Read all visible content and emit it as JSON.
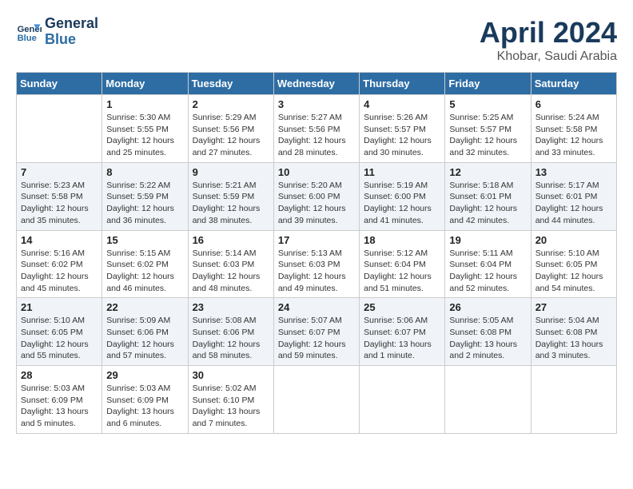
{
  "header": {
    "logo_line1": "General",
    "logo_line2": "Blue",
    "month_title": "April 2024",
    "location": "Khobar, Saudi Arabia"
  },
  "days_of_week": [
    "Sunday",
    "Monday",
    "Tuesday",
    "Wednesday",
    "Thursday",
    "Friday",
    "Saturday"
  ],
  "weeks": [
    [
      {
        "day": "",
        "info": ""
      },
      {
        "day": "1",
        "info": "Sunrise: 5:30 AM\nSunset: 5:55 PM\nDaylight: 12 hours\nand 25 minutes."
      },
      {
        "day": "2",
        "info": "Sunrise: 5:29 AM\nSunset: 5:56 PM\nDaylight: 12 hours\nand 27 minutes."
      },
      {
        "day": "3",
        "info": "Sunrise: 5:27 AM\nSunset: 5:56 PM\nDaylight: 12 hours\nand 28 minutes."
      },
      {
        "day": "4",
        "info": "Sunrise: 5:26 AM\nSunset: 5:57 PM\nDaylight: 12 hours\nand 30 minutes."
      },
      {
        "day": "5",
        "info": "Sunrise: 5:25 AM\nSunset: 5:57 PM\nDaylight: 12 hours\nand 32 minutes."
      },
      {
        "day": "6",
        "info": "Sunrise: 5:24 AM\nSunset: 5:58 PM\nDaylight: 12 hours\nand 33 minutes."
      }
    ],
    [
      {
        "day": "7",
        "info": "Sunrise: 5:23 AM\nSunset: 5:58 PM\nDaylight: 12 hours\nand 35 minutes."
      },
      {
        "day": "8",
        "info": "Sunrise: 5:22 AM\nSunset: 5:59 PM\nDaylight: 12 hours\nand 36 minutes."
      },
      {
        "day": "9",
        "info": "Sunrise: 5:21 AM\nSunset: 5:59 PM\nDaylight: 12 hours\nand 38 minutes."
      },
      {
        "day": "10",
        "info": "Sunrise: 5:20 AM\nSunset: 6:00 PM\nDaylight: 12 hours\nand 39 minutes."
      },
      {
        "day": "11",
        "info": "Sunrise: 5:19 AM\nSunset: 6:00 PM\nDaylight: 12 hours\nand 41 minutes."
      },
      {
        "day": "12",
        "info": "Sunrise: 5:18 AM\nSunset: 6:01 PM\nDaylight: 12 hours\nand 42 minutes."
      },
      {
        "day": "13",
        "info": "Sunrise: 5:17 AM\nSunset: 6:01 PM\nDaylight: 12 hours\nand 44 minutes."
      }
    ],
    [
      {
        "day": "14",
        "info": "Sunrise: 5:16 AM\nSunset: 6:02 PM\nDaylight: 12 hours\nand 45 minutes."
      },
      {
        "day": "15",
        "info": "Sunrise: 5:15 AM\nSunset: 6:02 PM\nDaylight: 12 hours\nand 46 minutes."
      },
      {
        "day": "16",
        "info": "Sunrise: 5:14 AM\nSunset: 6:03 PM\nDaylight: 12 hours\nand 48 minutes."
      },
      {
        "day": "17",
        "info": "Sunrise: 5:13 AM\nSunset: 6:03 PM\nDaylight: 12 hours\nand 49 minutes."
      },
      {
        "day": "18",
        "info": "Sunrise: 5:12 AM\nSunset: 6:04 PM\nDaylight: 12 hours\nand 51 minutes."
      },
      {
        "day": "19",
        "info": "Sunrise: 5:11 AM\nSunset: 6:04 PM\nDaylight: 12 hours\nand 52 minutes."
      },
      {
        "day": "20",
        "info": "Sunrise: 5:10 AM\nSunset: 6:05 PM\nDaylight: 12 hours\nand 54 minutes."
      }
    ],
    [
      {
        "day": "21",
        "info": "Sunrise: 5:10 AM\nSunset: 6:05 PM\nDaylight: 12 hours\nand 55 minutes."
      },
      {
        "day": "22",
        "info": "Sunrise: 5:09 AM\nSunset: 6:06 PM\nDaylight: 12 hours\nand 57 minutes."
      },
      {
        "day": "23",
        "info": "Sunrise: 5:08 AM\nSunset: 6:06 PM\nDaylight: 12 hours\nand 58 minutes."
      },
      {
        "day": "24",
        "info": "Sunrise: 5:07 AM\nSunset: 6:07 PM\nDaylight: 12 hours\nand 59 minutes."
      },
      {
        "day": "25",
        "info": "Sunrise: 5:06 AM\nSunset: 6:07 PM\nDaylight: 13 hours\nand 1 minute."
      },
      {
        "day": "26",
        "info": "Sunrise: 5:05 AM\nSunset: 6:08 PM\nDaylight: 13 hours\nand 2 minutes."
      },
      {
        "day": "27",
        "info": "Sunrise: 5:04 AM\nSunset: 6:08 PM\nDaylight: 13 hours\nand 3 minutes."
      }
    ],
    [
      {
        "day": "28",
        "info": "Sunrise: 5:03 AM\nSunset: 6:09 PM\nDaylight: 13 hours\nand 5 minutes."
      },
      {
        "day": "29",
        "info": "Sunrise: 5:03 AM\nSunset: 6:09 PM\nDaylight: 13 hours\nand 6 minutes."
      },
      {
        "day": "30",
        "info": "Sunrise: 5:02 AM\nSunset: 6:10 PM\nDaylight: 13 hours\nand 7 minutes."
      },
      {
        "day": "",
        "info": ""
      },
      {
        "day": "",
        "info": ""
      },
      {
        "day": "",
        "info": ""
      },
      {
        "day": "",
        "info": ""
      }
    ]
  ]
}
